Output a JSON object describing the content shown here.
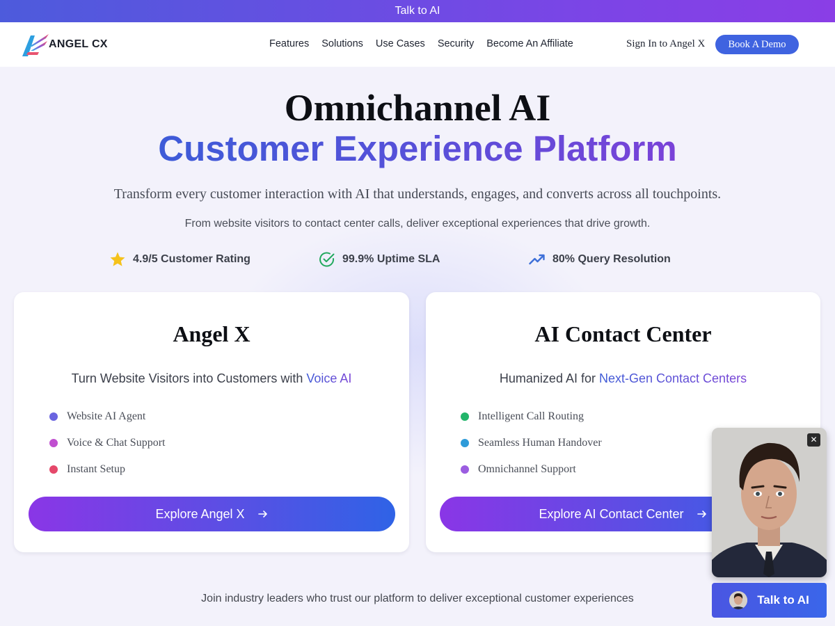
{
  "topbar": {
    "label": "Talk to AI"
  },
  "brand": {
    "name": "ANGEL CX"
  },
  "nav": {
    "links": [
      "Features",
      "Solutions",
      "Use Cases",
      "Security",
      "Become An Affiliate"
    ],
    "signin": "Sign In to Angel X",
    "demo": "Book A Demo"
  },
  "hero": {
    "title_line1": "Omnichannel AI",
    "title_line2": "Customer Experience Platform",
    "subtitle": "Transform every customer interaction with AI that understands, engages, and converts across all touchpoints.",
    "subtext": "From website visitors to contact center calls, deliver exceptional experiences that drive growth."
  },
  "stats": [
    {
      "label": "4.9/5 Customer Rating",
      "icon": "star-icon"
    },
    {
      "label": "99.9% Uptime SLA",
      "icon": "check-circle-icon"
    },
    {
      "label": "80% Query Resolution",
      "icon": "trending-up-icon"
    }
  ],
  "cards": [
    {
      "title": "Angel X",
      "sub_prefix": "Turn Website Visitors into Customers with ",
      "sub_highlight": "Voice AI",
      "features": [
        {
          "label": "Website AI Agent",
          "color": "#6a64e0"
        },
        {
          "label": "Voice & Chat Support",
          "color": "#c04fd0"
        },
        {
          "label": "Instant Setup",
          "color": "#e5486a"
        }
      ],
      "cta": "Explore Angel X"
    },
    {
      "title": "AI Contact Center",
      "sub_prefix": "Humanized AI for ",
      "sub_highlight": "Next-Gen Contact Centers",
      "features": [
        {
          "label": "Intelligent Call Routing",
          "color": "#22b56a"
        },
        {
          "label": "Seamless Human Handover",
          "color": "#2e9bd9"
        },
        {
          "label": "Omnichannel Support",
          "color": "#9b5de0"
        }
      ],
      "cta": "Explore AI Contact Center"
    }
  ],
  "footer": {
    "text": "Join industry leaders who trust our platform to deliver exceptional customer experiences"
  },
  "widget": {
    "close": "✕",
    "talk_label": "Talk to AI"
  },
  "colors": {
    "accent": "#3f63e0",
    "gradient_start": "#8a36e6",
    "gradient_end": "#2f63e6"
  }
}
